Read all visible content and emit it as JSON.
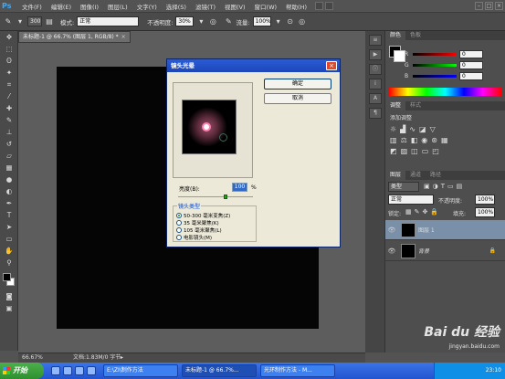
{
  "menu": {
    "logo": "Ps",
    "items": [
      "文件(F)",
      "编辑(E)",
      "图像(I)",
      "图层(L)",
      "文字(Y)",
      "选择(S)",
      "滤镜(T)",
      "视图(V)",
      "窗口(W)",
      "帮助(H)"
    ]
  },
  "options": {
    "brush_size": "300",
    "mode_label": "模式:",
    "mode_value": "正常",
    "opacity_label": "不透明度:",
    "opacity_value": "30%",
    "flow_label": "流量:",
    "flow_value": "100%"
  },
  "document": {
    "tab_title": "未标题-1 @ 66.7% (图层 1, RGB/8) *",
    "zoom": "66.67%",
    "doc_size": "文档:1.83M/0 字节"
  },
  "color_panel": {
    "tabs": [
      "颜色",
      "色板"
    ],
    "r_value": "0",
    "g_value": "0",
    "b_value": "0"
  },
  "adjust_panel": {
    "tabs": [
      "调整",
      "样式"
    ],
    "add_label": "添加调整"
  },
  "layers_panel": {
    "tabs": [
      "图层",
      "通道",
      "路径"
    ],
    "kind": "类型",
    "blend_mode": "正常",
    "opacity_label": "不透明度:",
    "opacity_value": "100%",
    "lock_label": "锁定:",
    "fill_label": "填充:",
    "fill_value": "100%",
    "layers": [
      {
        "name": "图层 1"
      },
      {
        "name": "背景"
      }
    ]
  },
  "dialog": {
    "title": "镜头光晕",
    "ok_label": "确定",
    "cancel_label": "取消",
    "brightness_label": "亮度(B):",
    "brightness_value": "100",
    "brightness_unit": "%",
    "lens_group_label": "镜头类型",
    "lens_options": [
      "50-300 毫米变焦(Z)",
      "35 毫米聚焦(K)",
      "105 毫米聚焦(L)",
      "电影镜头(M)"
    ],
    "selected_lens": 0
  },
  "taskbar": {
    "start_label": "开始",
    "tasks": [
      "E:\\ZI\\制作方法",
      "未标题-1 @ 66.7%...",
      "光环制作方法 - M..."
    ],
    "clock": "23:10"
  },
  "watermark": {
    "brand": "Bai du 经验",
    "url": "jingyan.baidu.com"
  },
  "colors": {
    "app_bg": "#535353",
    "canvas": "#050505",
    "dialog_bg": "#ece9d8",
    "xp_blue": "#2254d0"
  }
}
